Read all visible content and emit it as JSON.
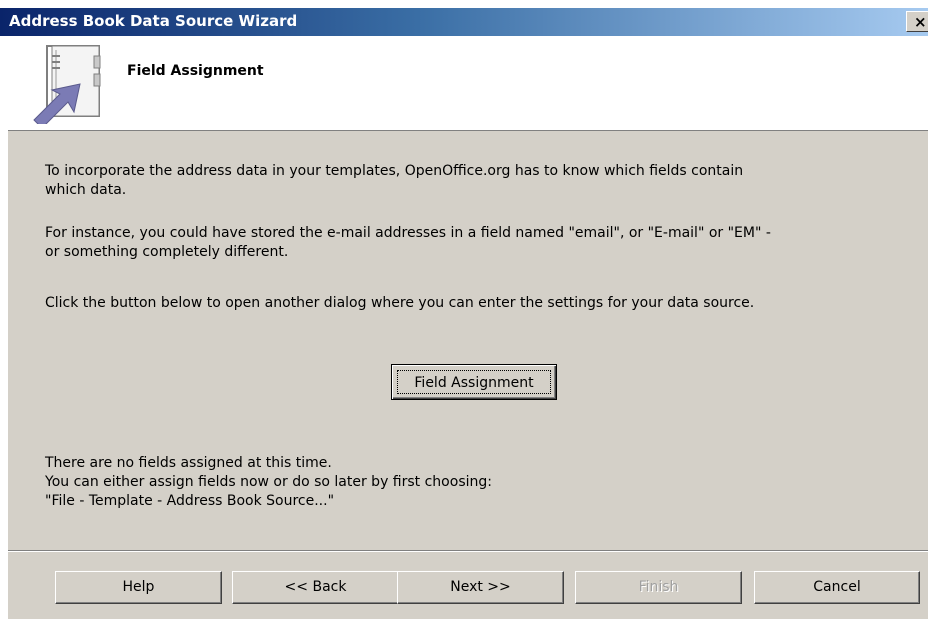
{
  "window": {
    "title": "Address Book Data Source Wizard",
    "close_label": "×"
  },
  "header": {
    "title": "Field Assignment",
    "icon": "address-book-icon"
  },
  "content": {
    "paragraph1_line1": "To incorporate the address data in your templates, OpenOffice.org has to know which fields contain",
    "paragraph1_line2": "which data.",
    "paragraph2_line1": "For instance, you could have stored the e-mail addresses in a field named \"email\", or \"E-mail\" or \"EM\" -",
    "paragraph2_line2": "or something completely different.",
    "paragraph3": "Click the button below to open another dialog where you can enter the settings for your data source.",
    "field_assignment_button": "Field Assignment",
    "status_line1": "There are no fields assigned at this time.",
    "status_line2": "You can either assign fields now or do so later by first choosing:",
    "status_line3": "\"File - Template - Address Book Source...\""
  },
  "buttons": {
    "help": "Help",
    "back": "<< Back",
    "next": "Next >>",
    "finish": "Finish",
    "cancel": "Cancel"
  }
}
